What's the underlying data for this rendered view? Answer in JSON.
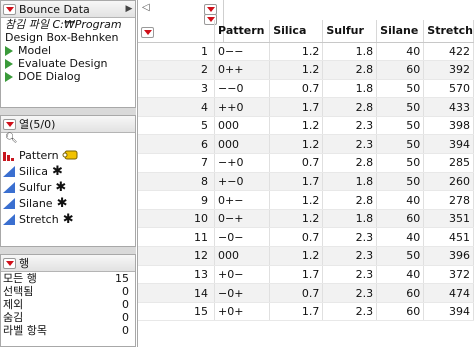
{
  "table_panel": {
    "title": "Bounce Data",
    "note_line1": "참김 파일  C:₩Program",
    "note_line2": "Design     Box-Behnken"
  },
  "scripts": [
    {
      "label": "Model"
    },
    {
      "label": "Evaluate Design"
    },
    {
      "label": "DOE Dialog"
    }
  ],
  "columns_panel": {
    "title": "열(5/0)",
    "search_glyph": "ﾟ"
  },
  "columns": [
    {
      "label": "Pattern"
    },
    {
      "label": "Silica"
    },
    {
      "label": "Sulfur"
    },
    {
      "label": "Silane"
    },
    {
      "label": "Stretch"
    }
  ],
  "rows_panel": {
    "title": "행",
    "items": [
      {
        "label": "모든 행",
        "value": "15"
      },
      {
        "label": "선택됨",
        "value": "0"
      },
      {
        "label": "제외",
        "value": "0"
      },
      {
        "label": "숨김",
        "value": "0"
      },
      {
        "label": "라벨 항목",
        "value": "0"
      }
    ]
  },
  "grid": {
    "headers": [
      "Pattern",
      "Silica",
      "Sulfur",
      "Silane",
      "Stretch"
    ],
    "rows": [
      {
        "n": "1",
        "pattern": "0−−",
        "silica": "1.2",
        "sulfur": "1.8",
        "silane": "40",
        "stretch": "422"
      },
      {
        "n": "2",
        "pattern": "0++",
        "silica": "1.2",
        "sulfur": "2.8",
        "silane": "60",
        "stretch": "392"
      },
      {
        "n": "3",
        "pattern": "−−0",
        "silica": "0.7",
        "sulfur": "1.8",
        "silane": "50",
        "stretch": "570"
      },
      {
        "n": "4",
        "pattern": "++0",
        "silica": "1.7",
        "sulfur": "2.8",
        "silane": "50",
        "stretch": "433"
      },
      {
        "n": "5",
        "pattern": "000",
        "silica": "1.2",
        "sulfur": "2.3",
        "silane": "50",
        "stretch": "398"
      },
      {
        "n": "6",
        "pattern": "000",
        "silica": "1.2",
        "sulfur": "2.3",
        "silane": "50",
        "stretch": "394"
      },
      {
        "n": "7",
        "pattern": "−+0",
        "silica": "0.7",
        "sulfur": "2.8",
        "silane": "50",
        "stretch": "285"
      },
      {
        "n": "8",
        "pattern": "+−0",
        "silica": "1.7",
        "sulfur": "1.8",
        "silane": "50",
        "stretch": "260"
      },
      {
        "n": "9",
        "pattern": "0+−",
        "silica": "1.2",
        "sulfur": "2.8",
        "silane": "40",
        "stretch": "278"
      },
      {
        "n": "10",
        "pattern": "0−+",
        "silica": "1.2",
        "sulfur": "1.8",
        "silane": "60",
        "stretch": "351"
      },
      {
        "n": "11",
        "pattern": "−0−",
        "silica": "0.7",
        "sulfur": "2.3",
        "silane": "40",
        "stretch": "451"
      },
      {
        "n": "12",
        "pattern": "000",
        "silica": "1.2",
        "sulfur": "2.3",
        "silane": "50",
        "stretch": "396"
      },
      {
        "n": "13",
        "pattern": "+0−",
        "silica": "1.7",
        "sulfur": "2.3",
        "silane": "40",
        "stretch": "372"
      },
      {
        "n": "14",
        "pattern": "−0+",
        "silica": "0.7",
        "sulfur": "2.3",
        "silane": "60",
        "stretch": "474"
      },
      {
        "n": "15",
        "pattern": "+0+",
        "silica": "1.7",
        "sulfur": "2.3",
        "silane": "60",
        "stretch": "394"
      }
    ]
  },
  "icons": {
    "column_icons": [
      "nominal-bars-icon",
      "continuous-triangle-icon"
    ],
    "scripts": "green-play-icon",
    "menus": "red-triangle-menu-icon"
  },
  "colors": {
    "accent_red": "#d0101a",
    "script_green": "#3a9a3a",
    "continuous_blue": "#3a6fd0"
  }
}
